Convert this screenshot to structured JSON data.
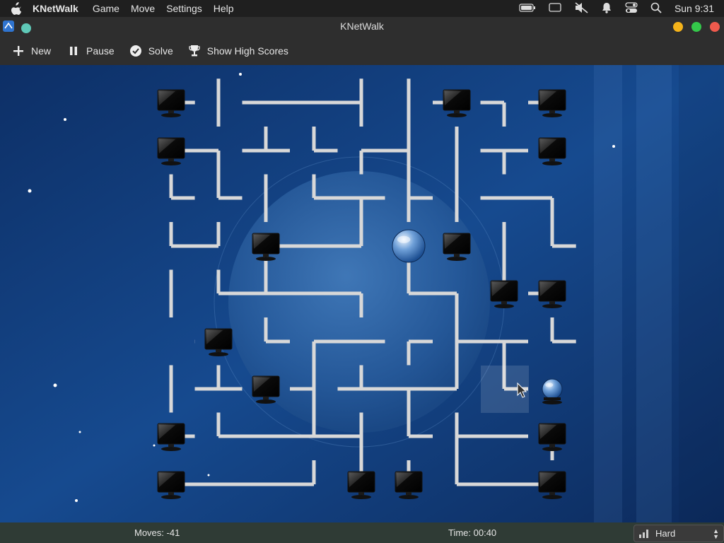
{
  "menubar": {
    "app_name": "KNetWalk",
    "menus": [
      "Game",
      "Move",
      "Settings",
      "Help"
    ],
    "clock": "Sun 9:31"
  },
  "window": {
    "title": "KNetWalk",
    "buttons": {
      "minimize_color": "#f5b31a",
      "maximize_color": "#34c84a",
      "close_color": "#f05a4d"
    }
  },
  "toolbar": {
    "new_label": "New",
    "pause_label": "Pause",
    "solve_label": "Solve",
    "highscores_label": "Show High Scores"
  },
  "board": {
    "grid_cols": 9,
    "grid_rows": 9,
    "background_color": "#123a78"
  },
  "status": {
    "moves": "Moves: -41",
    "time": "Time: 00:40",
    "difficulty": "Hard"
  },
  "colors": {
    "accent": "#5fc9b8",
    "pipe": "#d8d8d8"
  }
}
